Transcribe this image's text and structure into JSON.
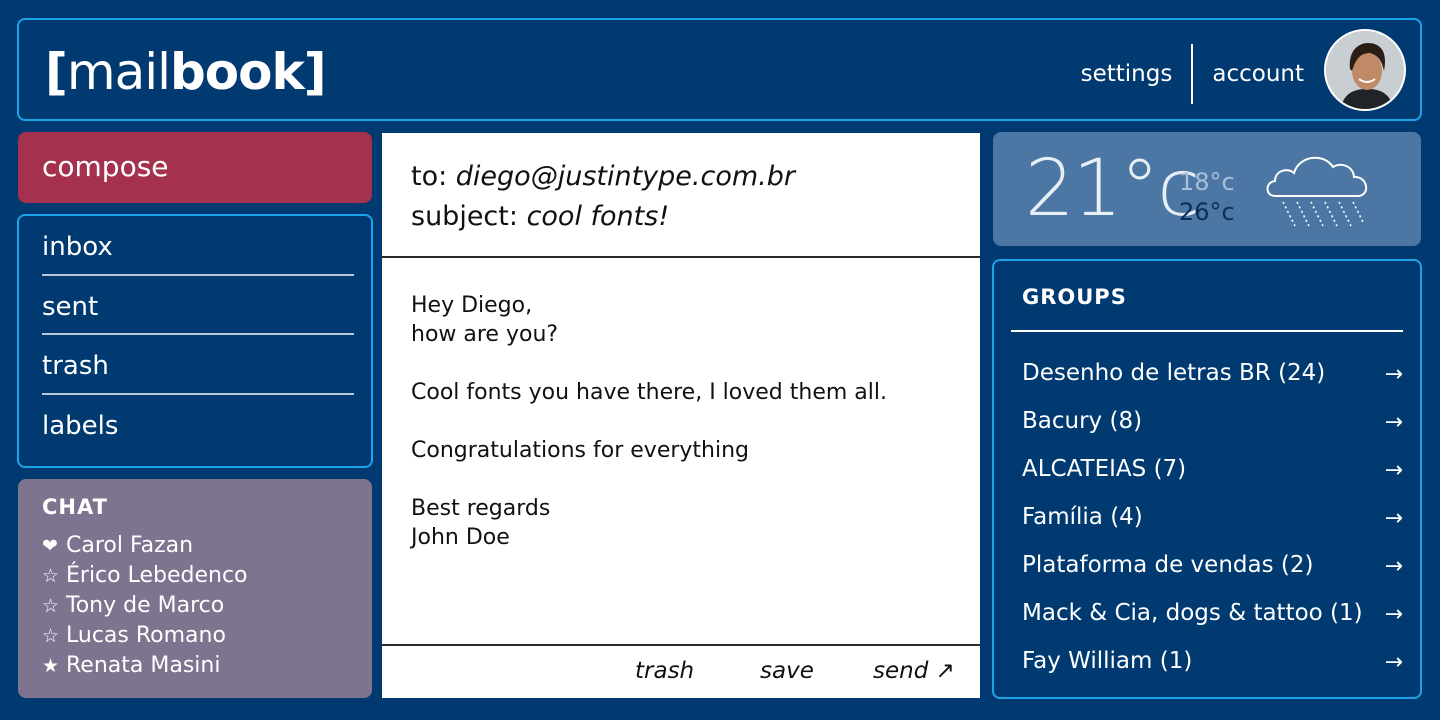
{
  "header": {
    "logo_open": "[",
    "logo_light": "mail",
    "logo_bold": "book",
    "logo_close": "]",
    "settings_label": "settings",
    "account_label": "account"
  },
  "sidebar": {
    "compose_label": "compose",
    "nav": [
      {
        "label": "inbox"
      },
      {
        "label": "sent"
      },
      {
        "label": "trash"
      },
      {
        "label": "labels"
      }
    ]
  },
  "chat": {
    "title": "CHAT",
    "contacts": [
      {
        "icon": "heart-icon",
        "glyph": "❤",
        "name": "Carol Fazan"
      },
      {
        "icon": "star-outline-icon",
        "glyph": "☆",
        "name": "Érico Lebedenco"
      },
      {
        "icon": "star-outline-icon",
        "glyph": "☆",
        "name": "Tony de Marco"
      },
      {
        "icon": "star-outline-icon",
        "glyph": "☆",
        "name": "Lucas Romano"
      },
      {
        "icon": "star-filled-icon",
        "glyph": "★",
        "name": "Renata Masini"
      }
    ]
  },
  "email": {
    "to_label": "to:",
    "to_value": "diego@justintype.com.br",
    "subject_label": "subject:",
    "subject_value": "cool fonts!",
    "body_lines": [
      "Hey Diego,",
      "how are you?",
      "Cool fonts you have there, I loved them all.",
      "Congratulations for everything",
      "Best regards",
      "John Doe"
    ],
    "trash_label": "trash",
    "save_label": "save",
    "send_label": "send ↗"
  },
  "weather": {
    "temp": "21°c",
    "low": "18°c",
    "high": "26°c",
    "icon": "rain-cloud-icon",
    "colors": {
      "panel": "#4c77a4",
      "low": "#a8bfd8",
      "high": "#0b2e57"
    }
  },
  "groups": {
    "title": "GROUPS",
    "items": [
      {
        "label": "Desenho de letras BR (24)"
      },
      {
        "label": "Bacury (8)"
      },
      {
        "label": "ALCATEIAS (7)"
      },
      {
        "label": "Família (4)"
      },
      {
        "label": "Plataforma de vendas (2)"
      },
      {
        "label": "Mack & Cia, dogs & tattoo (1)"
      },
      {
        "label": "Fay William (1)"
      }
    ],
    "arrow_glyph": "→"
  },
  "theme": {
    "background": "#003a70",
    "border_accent": "#1fa3e8",
    "compose": "#a4314d",
    "chat_panel": "#7e7490"
  }
}
